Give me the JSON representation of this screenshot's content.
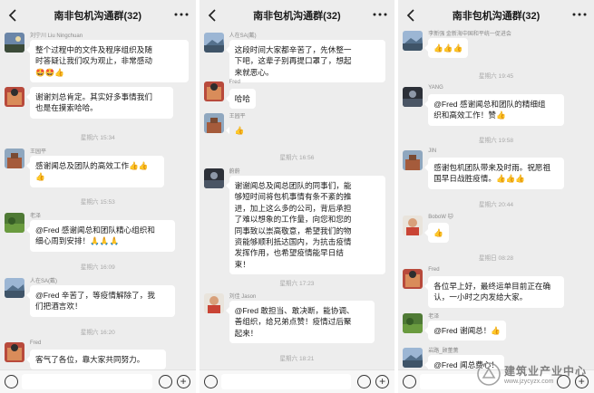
{
  "chat_title": "南非包机沟通群(32)",
  "panels": [
    {
      "messages": [
        {
          "sender": "刘宁川 Liu Ningchuan",
          "text": "整个过程中的文件及程序组织及随\n时答疑让我们叹为观止，非常感动\n🤩🤩👍",
          "avatar": "photo-avatar-landscape"
        },
        {
          "sender": "",
          "text": "谢谢刘总肯定。其实好多事情我们\n也是在摸索哈哈。",
          "avatar": "photo-avatar-red"
        }
      ],
      "stamps": [
        "星期六 15:34",
        "星期六 15:53",
        "星期六 16:09",
        "星期六 16:20"
      ],
      "messages2": [
        {
          "sender": "王园平",
          "text": "感谢闻总及团队的高效工作👍👍\n👍",
          "avatar": "photo-avatar-building"
        },
        {
          "sender": "老泽",
          "text": "@Fred 感谢闻总和团队精心组织和\n细心周到安排！🙏🙏🙏",
          "avatar": "photo-avatar-green"
        },
        {
          "sender": "人在SA(戴)",
          "text": "@Fred 辛苦了，等疫情解除了，我\n们把酒言欢！",
          "avatar": "photo-avatar-sky"
        },
        {
          "sender": "Fred",
          "text": "客气了各位，靠大家共同努力。",
          "avatar": "photo-avatar-red"
        }
      ]
    },
    {
      "messages": [
        {
          "sender": "人在SA(戴)",
          "text": "这段时间大家都辛苦了，先休整一\n下吧，这辈子别再提口罩了，想起\n来就恶心。",
          "avatar": "photo-avatar-sky"
        },
        {
          "sender": "Fred",
          "text": "哈哈",
          "avatar": "photo-avatar-red"
        },
        {
          "sender": "王园平",
          "text": "👍",
          "avatar": "photo-avatar-building"
        }
      ],
      "stamps": [
        "星期六 16:56",
        "星期六 17:23",
        "星期六 18:21"
      ],
      "messages2": [
        {
          "sender": "蔚蔚",
          "text": "谢谢闻总及闻总团队的同事们，能\n够短时间将包机事情有条不紊的推\n进，加上这么多的公司，背后承担\n了难以想象的工作量，向您和您的\n同事致以崇高敬意，希望我们的物\n资能够顺利抵达国内，为抗击疫情\n发挥作用，也希望疫情能早日结\n束！",
          "avatar": "photo-avatar-dark"
        },
        {
          "sender": "刘佳 Jason",
          "text": "@Fred 敢担当、敢决断，能协调、\n善组织，给兄弟点赞！疫情过后聚\n起来！",
          "avatar": "photo-avatar-person"
        }
      ]
    },
    {
      "messages": [
        {
          "sender": "李新强 金新海中国和平统一促进会",
          "text": "👍👍👍",
          "avatar": "photo-avatar-sky"
        }
      ],
      "stamps": [
        "星期六 19:45",
        "星期六 19:58",
        "星期六 20:44",
        "星期日 08:28"
      ],
      "messages2": [
        {
          "sender": "YANG",
          "text": "@Fred 感谢闻总和团队的精细组\n织和高效工作！赞👍",
          "avatar": "photo-avatar-dark"
        },
        {
          "sender": "JIN",
          "text": "感谢包机团队带来及时雨。祝愿祖\n国早日战胜疫情。👍👍👍",
          "avatar": "photo-avatar-building"
        },
        {
          "sender": "BoboW 🐱",
          "text": "👍",
          "avatar": "photo-avatar-person"
        },
        {
          "sender": "Fred",
          "text": "各位早上好，最终运单目前正在确\n认，一小时之内发给大家。",
          "avatar": "photo-avatar-red"
        },
        {
          "sender": "老泽",
          "text": "@Fred 谢闻总！👍",
          "avatar": "photo-avatar-green"
        },
        {
          "sender": "岩路_顾董薰",
          "text": "@Fred 闻总费心！",
          "avatar": "photo-avatar-sky"
        }
      ]
    }
  ],
  "watermark": {
    "title": "建筑业产业中心",
    "url": "www.jzycyzx.com"
  },
  "icons": [
    "back-chevron-icon",
    "more-dots-icon",
    "voice-icon",
    "emoji-icon",
    "plus-icon"
  ],
  "colors": {
    "chat_bg": "#ededed",
    "bubble": "#ffffff",
    "timestamp": "#a8a8a8"
  }
}
